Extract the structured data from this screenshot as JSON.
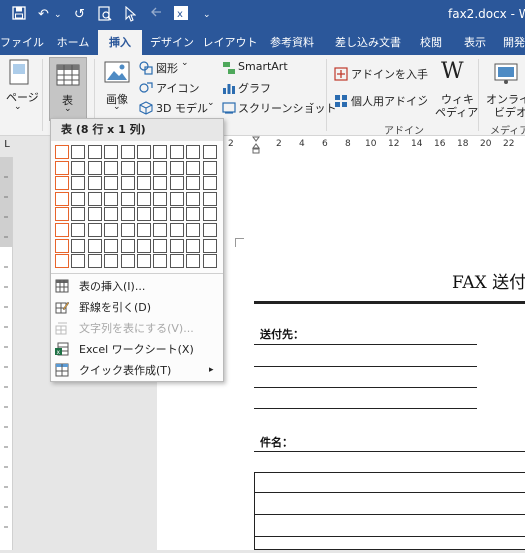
{
  "title_bar": {
    "doc_title": "fax2.docx - W",
    "undo_icon": "↶",
    "redo_icon": "↺",
    "dropdown_arrow": "⌄",
    "save_icon": "save-icon",
    "more_icon": "⌄"
  },
  "tabs": [
    "ファイル",
    "ホーム",
    "挿入",
    "デザイン",
    "レイアウト",
    "参考資料",
    "差し込み文書",
    "校閲",
    "表示",
    "開発"
  ],
  "active_tab": "挿入",
  "ribbon": {
    "page_label": "ページ",
    "table_label": "表",
    "image_label": "画像",
    "shapes_label": "図形",
    "icons_label": "アイコン",
    "model3d_label": "3D モデル",
    "smartart_label": "SmartArt",
    "graph_label": "グラフ",
    "screenshot_label": "スクリーンショット",
    "addin_get_label": "アドインを入手",
    "personal_addin_label": "個人用アドイン",
    "wiki_label_1": "ウィキ",
    "wiki_label_2": "ペディア",
    "wiki_glyph": "W",
    "online_video_label_1": "オンライン",
    "online_video_label_2": "ビデオ",
    "group_addin": "アドイン",
    "group_media": "メディア",
    "chevron": "⌄"
  },
  "ruler": {
    "corner": "L",
    "numbers": [
      "2",
      "2",
      "4",
      "6",
      "8",
      "10",
      "12",
      "14",
      "16",
      "18",
      "20",
      "22"
    ]
  },
  "table_dropdown": {
    "header": "表 (8 行 x 1 列)",
    "grid_rows": 8,
    "grid_cols": 10,
    "selected_rows": 8,
    "selected_cols": 1,
    "items": [
      {
        "label": "表の挿入(I)...",
        "disabled": false,
        "icon": "table-icon"
      },
      {
        "label": "罫線を引く(D)",
        "disabled": false,
        "icon": "pencil-icon"
      },
      {
        "label": "文字列を表にする(V)...",
        "disabled": true,
        "icon": "convert-icon"
      },
      {
        "label": "Excel ワークシート(X)",
        "disabled": false,
        "icon": "excel-icon"
      },
      {
        "label": "クイック表作成(T)",
        "disabled": false,
        "icon": "quick-table-icon",
        "submenu_arrow": "▸"
      }
    ]
  },
  "document": {
    "fax_title": "FAX 送付",
    "sender_label": "送付先：",
    "subject_label": "件名："
  }
}
